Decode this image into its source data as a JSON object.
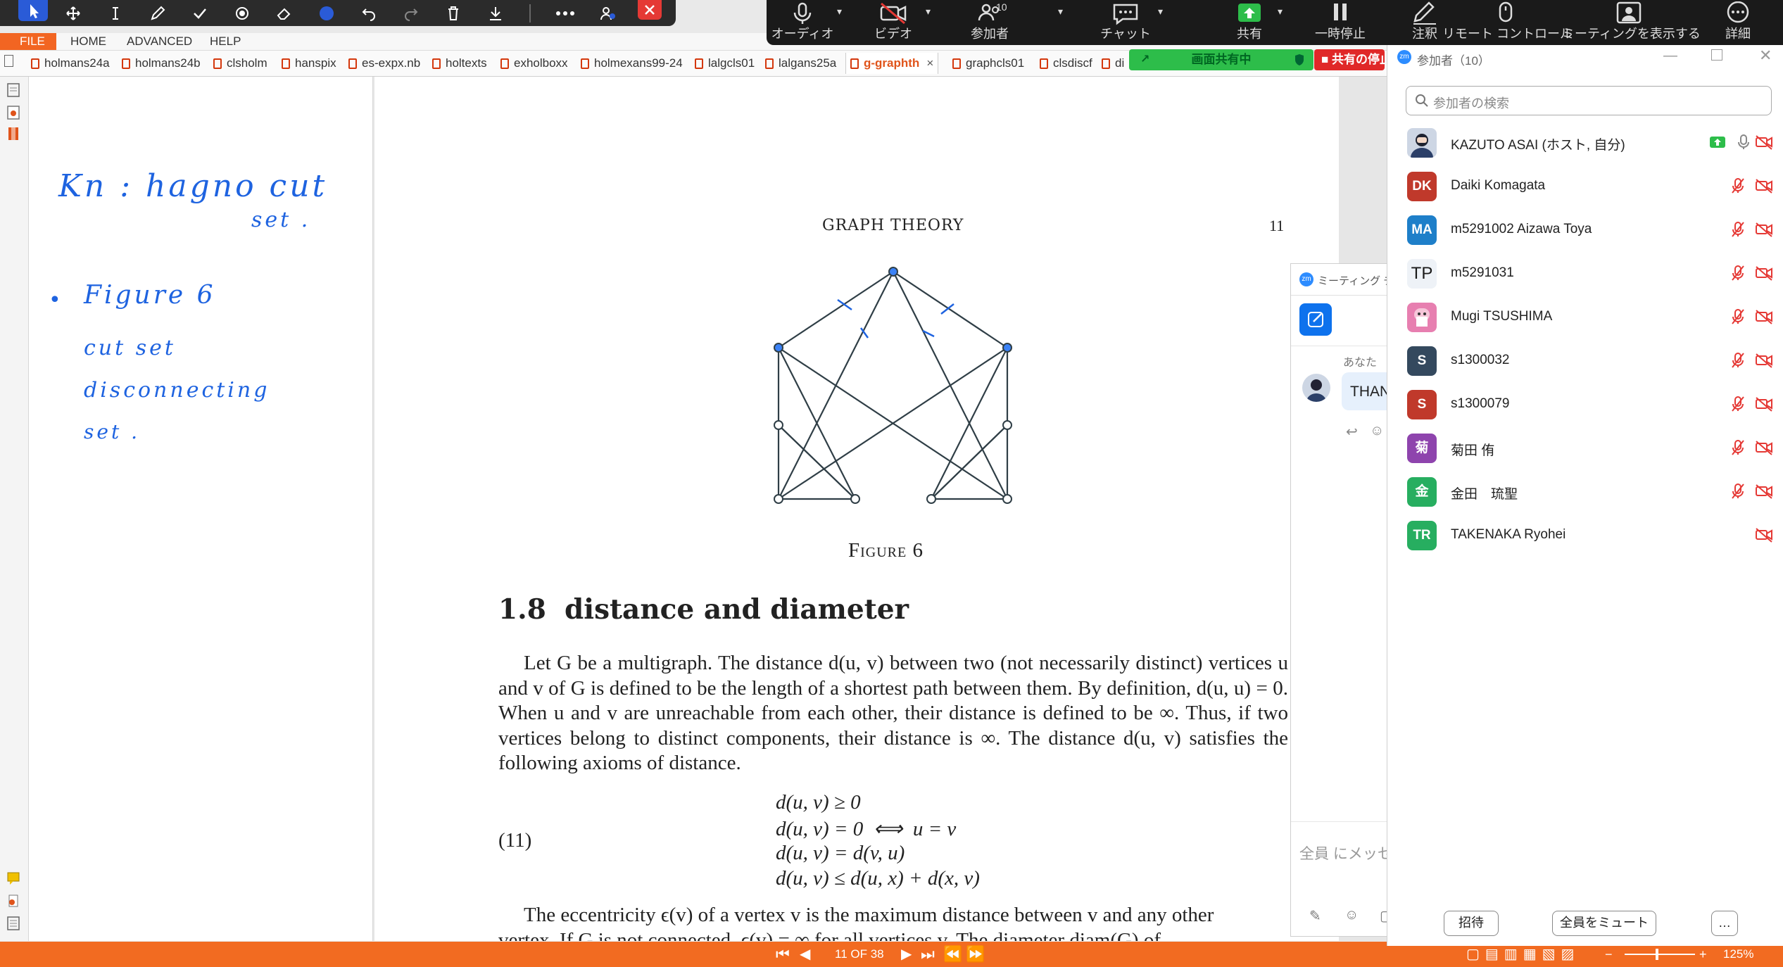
{
  "annotation_toolbar": {
    "icons": [
      "select-arrow-icon",
      "pan-move-icon",
      "text-cursor-icon",
      "pen-icon",
      "checkmark-icon",
      "stamp-icon",
      "eraser-icon",
      "color-swatch-icon",
      "undo-icon",
      "redo-icon",
      "trash-icon",
      "download-icon",
      "more-icon",
      "participants-icon",
      "close-icon"
    ],
    "swatch_color": "#2a5bd7",
    "close_color": "#e53935"
  },
  "viewer": {
    "menu": [
      "FILE",
      "HOME",
      "ADVANCED",
      "HELP"
    ],
    "tabs": [
      "holmans24a",
      "holmans24b",
      "clsholm",
      "hanspix",
      "es-expx.nb",
      "holtexts",
      "exholboxx",
      "holmexans99-24",
      "lalgcls01",
      "lalgans25a",
      "g-graphth",
      "graphcls01",
      "clsdiscf",
      "di"
    ],
    "active_tab": "g-graphth",
    "tab_close": "×",
    "accent": "#f26b21",
    "status": {
      "page_indicator": "11 OF 38",
      "zoom": "125%"
    }
  },
  "handwritten_notes": {
    "line1": "Kn : hagno cut",
    "line1b": "set .",
    "bullet": "•",
    "line2": "Figure 6",
    "line3": "cut set",
    "line4": "disconnecting",
    "line5": "set ."
  },
  "document": {
    "running_header": "GRAPH THEORY",
    "page_number": "11",
    "figure_caption": "Figure 6",
    "section_number": "1.8",
    "section_title": "distance and diameter",
    "paragraph1": "Let G be a multigraph. The distance d(u, v) between two (not necessarily distinct) vertices u and v of G is defined to be the length of a shortest path between them. By definition, d(u, u) = 0. When u and v are unreachable from each other, their distance is defined to be ∞. Thus, if two vertices belong to distinct components, their distance is ∞. The distance d(u, v) satisfies the following axioms of distance.",
    "equation_number": "(11)",
    "equations": [
      "d(u, v) ≥ 0",
      "d(u, v) = 0  ⟺  u = v",
      "d(u, v) = d(v, u)",
      "d(u, v) ≤ d(u, x) + d(x, v)"
    ],
    "paragraph2": "The eccentricity ϵ(v) of a vertex v is the maximum distance between v and any other",
    "paragraph3": "vertex. If G is not connected, ϵ(v) = ∞ for all vertices v. The diameter diam(G) of"
  },
  "zoom_toolbar": {
    "buttons": [
      {
        "label": "オーディオ",
        "icon": "microphone-icon"
      },
      {
        "label": "ビデオ",
        "icon": "video-off-icon"
      },
      {
        "label": "参加者",
        "icon": "participants-icon",
        "count": "10"
      },
      {
        "label": "チャット",
        "icon": "chat-icon"
      },
      {
        "label": "共有",
        "icon": "share-screen-icon"
      },
      {
        "label": "一時停止",
        "icon": "pause-icon"
      },
      {
        "label": "注釈",
        "icon": "annotate-icon"
      },
      {
        "label": "リモート コントロール",
        "icon": "remote-control-icon"
      },
      {
        "label": "ミーティングを表示する",
        "icon": "show-meeting-icon"
      },
      {
        "label": "詳細",
        "icon": "more-icon"
      }
    ],
    "share_indicator": "画面共有中",
    "stop_share": "共有の停止"
  },
  "chat_panel": {
    "title": "ミーティング チャット",
    "sender": "あなた",
    "message_preview": "THAN",
    "input_placeholder": "全員 にメッセージを送信"
  },
  "participants_panel": {
    "title": "参加者（10）",
    "search_placeholder": "参加者の検索",
    "participants": [
      {
        "name": "KAZUTO ASAI (ホスト, 自分)",
        "initials": "",
        "color": "#9ab",
        "sharing": true,
        "mic": "on",
        "video": "off"
      },
      {
        "name": "Daiki Komagata",
        "initials": "DK",
        "color": "#c0392b",
        "mic": "muted",
        "video": "off"
      },
      {
        "name": "m5291002 Aizawa Toya",
        "initials": "MA",
        "color": "#1e7fc9",
        "mic": "muted",
        "video": "off"
      },
      {
        "name": "m5291031",
        "initials": "TP",
        "color": "#eef2f7",
        "mic": "muted",
        "video": "off"
      },
      {
        "name": "Mugi TSUSHIMA",
        "initials": "",
        "color": "#e77fb0",
        "mic": "muted",
        "video": "off"
      },
      {
        "name": "s1300032",
        "initials": "S",
        "color": "#34495e",
        "mic": "muted",
        "video": "off"
      },
      {
        "name": "s1300079",
        "initials": "S",
        "color": "#c0392b",
        "mic": "muted",
        "video": "off"
      },
      {
        "name": "菊田 侑",
        "initials": "菊",
        "color": "#8e44ad",
        "mic": "muted",
        "video": "off"
      },
      {
        "name": "金田　琉聖",
        "initials": "金",
        "color": "#27ae60",
        "mic": "muted",
        "video": "off"
      },
      {
        "name": "TAKENAKA Ryohei",
        "initials": "TR",
        "color": "#27ae60",
        "mic": "none",
        "video": "off"
      }
    ],
    "invite_label": "招待",
    "mute_all_label": "全員をミュート",
    "more_label": "…"
  }
}
